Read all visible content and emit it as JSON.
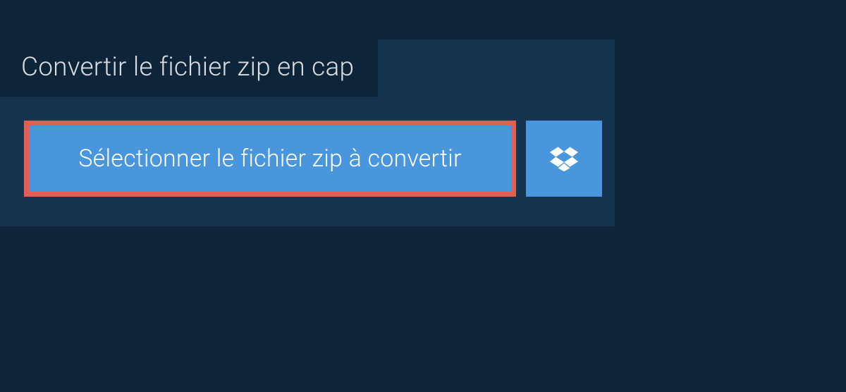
{
  "header": {
    "title": "Convertir le fichier zip en cap"
  },
  "actions": {
    "select_file_label": "Sélectionner le fichier zip à convertir",
    "dropbox_icon_name": "dropbox-icon"
  },
  "colors": {
    "background_dark": "#0d2439",
    "panel": "#163450",
    "button_blue": "#4a96dd",
    "highlight_border": "#e15e53",
    "text_light": "#d9dde1",
    "text_white": "#ffffff"
  }
}
